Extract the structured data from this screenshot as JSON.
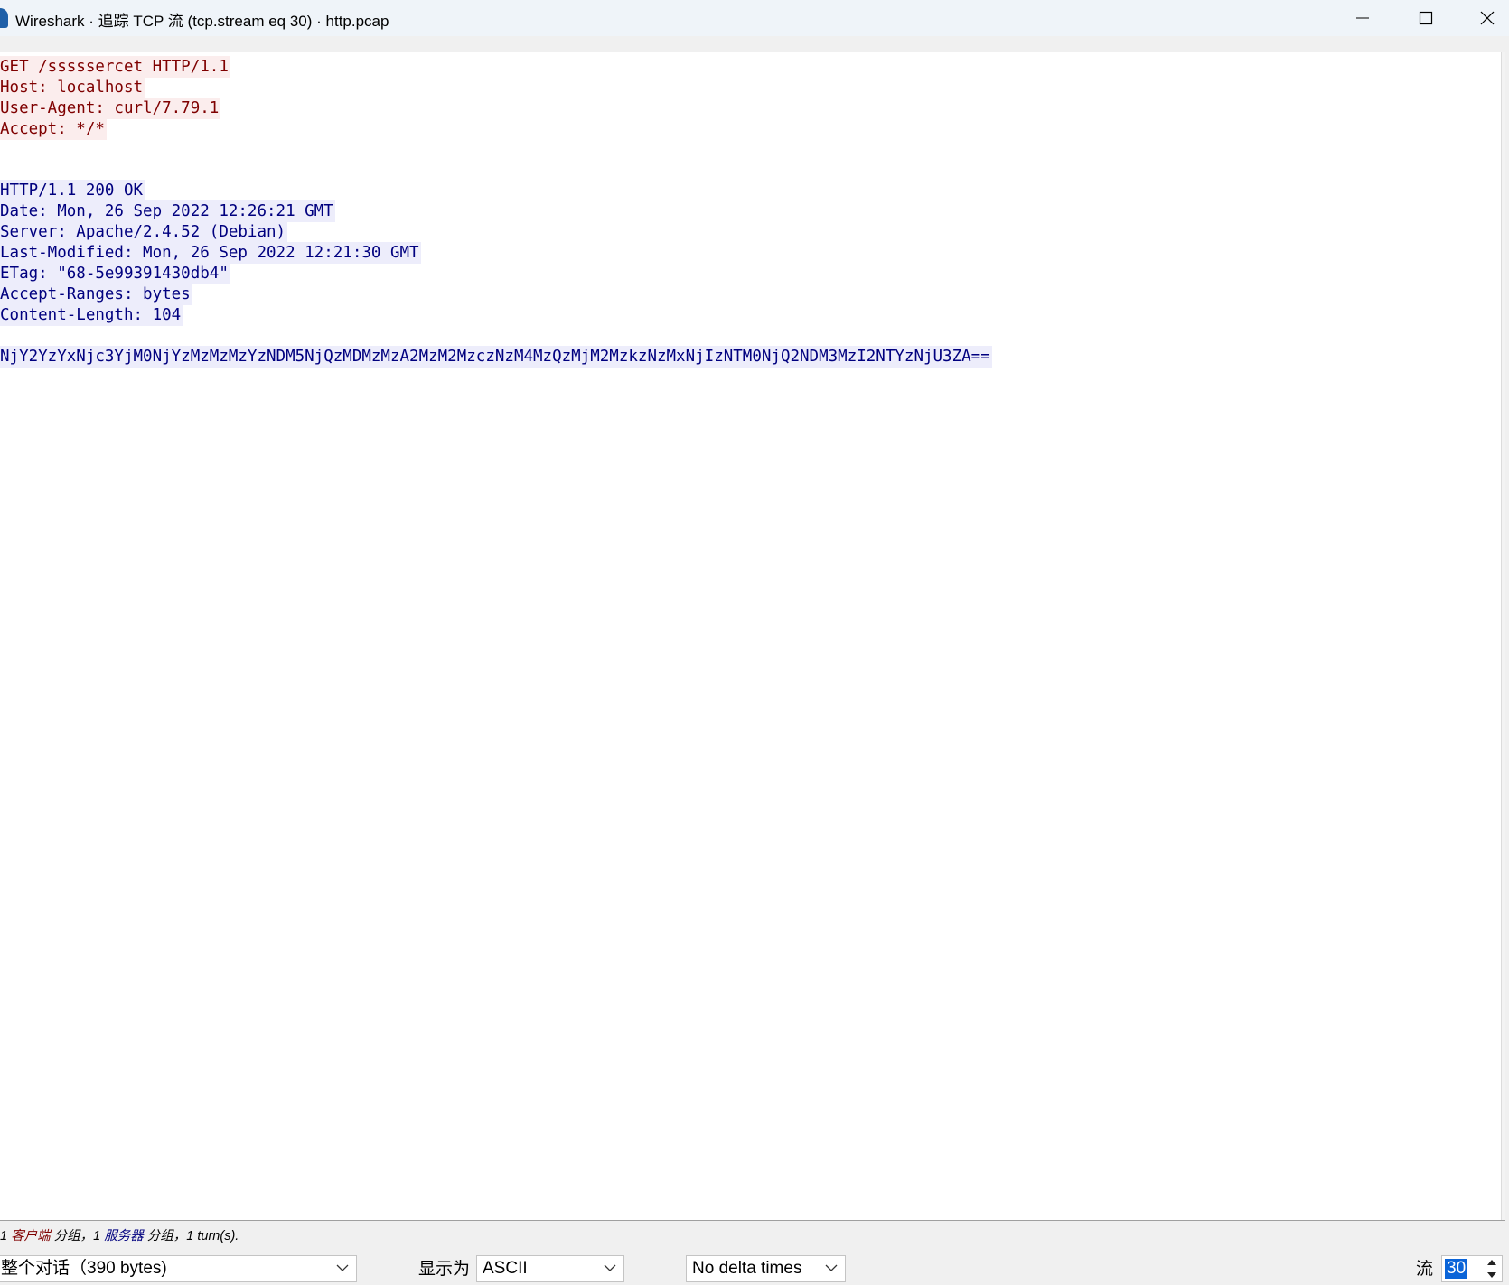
{
  "window": {
    "title": "Wireshark · 追踪 TCP 流 (tcp.stream eq 30) · http.pcap"
  },
  "stream": {
    "client_lines": [
      "GET /sssssercet HTTP/1.1",
      "Host: localhost",
      "User-Agent: curl/7.79.1",
      "Accept: */*"
    ],
    "server_lines": [
      "HTTP/1.1 200 OK",
      "Date: Mon, 26 Sep 2022 12:26:21 GMT",
      "Server: Apache/2.4.52 (Debian)",
      "Last-Modified: Mon, 26 Sep 2022 12:21:30 GMT",
      "ETag: \"68-5e99391430db4\"",
      "Accept-Ranges: bytes",
      "Content-Length: 104"
    ],
    "server_body": "NjY2YzYxNjc3YjM0NjYzMzMzMzYzNDM5NjQzMDMzMzA2MzM2MzczNzM4MzQzMjM2MzkzNzMxNjIzNTM0NjQ2NDM3MzI2NTYzNjU3ZA=="
  },
  "summary": {
    "lead": "1",
    "client_label": "客户端",
    "mid": "分组，1",
    "server_label": "服务器",
    "tail": "分组，1 turn(s)."
  },
  "controls": {
    "conversation_value": "整个对话（390 bytes)",
    "show_as_label": "显示为",
    "show_as_value": "ASCII",
    "delta_value": "No delta times",
    "stream_label": "流",
    "stream_value": "30"
  },
  "colors": {
    "client_text": "#7f0000",
    "client_bg": "#fbeded",
    "server_text": "#00007f",
    "server_bg": "#ededfb",
    "selection": "#0a64d8"
  },
  "icons": {
    "minimize": "minimize-icon",
    "maximize": "maximize-icon",
    "close": "close-icon",
    "dropdown": "chevron-down-icon",
    "spin_up": "spin-up-icon",
    "spin_down": "spin-down-icon"
  }
}
